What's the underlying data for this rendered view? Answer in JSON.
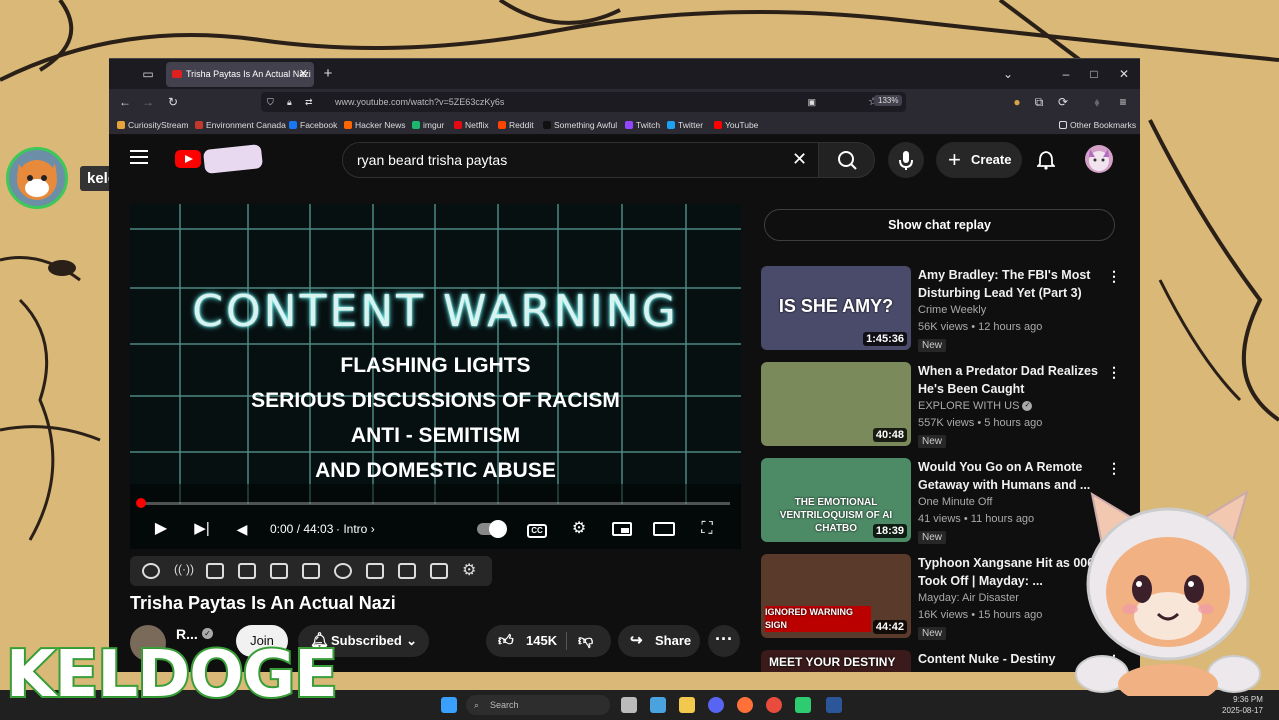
{
  "stream": {
    "username": "keldoge",
    "logo_text": "KELDOGE"
  },
  "browser": {
    "tab_title": "Trisha Paytas Is An Actual Nazi",
    "url": "www.youtube.com/watch?v=5ZE63czKy6s",
    "zoom": "133%",
    "bookmarks": [
      {
        "label": "CuriosityStream",
        "color": "#e6a23c"
      },
      {
        "label": "Environment Canada",
        "color": "#c0392b"
      },
      {
        "label": "Facebook",
        "color": "#1877f2"
      },
      {
        "label": "Hacker News",
        "color": "#ff6600"
      },
      {
        "label": "imgur",
        "color": "#1bb76e"
      },
      {
        "label": "Netflix",
        "color": "#e50914"
      },
      {
        "label": "Reddit",
        "color": "#ff4500"
      },
      {
        "label": "Something Awful",
        "color": "#333333"
      },
      {
        "label": "Twitch",
        "color": "#9146ff"
      },
      {
        "label": "Twitter",
        "color": "#1da1f2"
      },
      {
        "label": "YouTube",
        "color": "#ff0000"
      }
    ],
    "other_bookmarks": "Other Bookmarks"
  },
  "youtube": {
    "search_query": "ryan beard trisha paytas",
    "create_label": "Create",
    "player": {
      "warning_title": "CONTENT WARNING",
      "warning_lines": [
        "FLASHING LIGHTS",
        "SERIOUS DISCUSSIONS OF RACISM",
        "ANTI - SEMITISM",
        "AND DOMESTIC ABUSE"
      ],
      "time": "0:00 / 44:03",
      "chapter": "Intro",
      "cc": "CC",
      "progress": 0.0
    },
    "video_title": "Trisha Paytas Is An Actual Nazi",
    "channel_name": "R...",
    "join_label": "Join",
    "subscribed_label": "Subscribed",
    "likes": "145K",
    "share_label": "Share",
    "chat_replay_label": "Show chat replay",
    "recommendations": [
      {
        "title": "Amy Bradley: The FBI's Most Disturbing Lead Yet (Part 3)",
        "channel": "Crime Weekly",
        "verified": false,
        "views": "56K views",
        "age": "12 hours ago",
        "badge": "New",
        "duration": "1:45:36",
        "thumb_text": "IS SHE AMY?",
        "thumb_color": "#4a4a6a"
      },
      {
        "title": "When a Predator Dad Realizes He's Been Caught",
        "channel": "EXPLORE WITH US",
        "verified": true,
        "views": "557K views",
        "age": "5 hours ago",
        "badge": "New",
        "duration": "40:48",
        "thumb_text": "",
        "thumb_color": "#7a8a5a"
      },
      {
        "title": "Would You Go on A Remote Getaway with Humans and ...",
        "channel": "One Minute Off",
        "verified": false,
        "views": "41 views",
        "age": "11 hours ago",
        "badge": "New",
        "duration": "18:39",
        "thumb_text": "THE EMOTIONAL VENTRILOQUISM OF AI CHATBO",
        "thumb_color": "#4d8a66"
      },
      {
        "title": "Typhoon Xangsane Hit as 006 Took Off | Mayday: ...",
        "channel": "Mayday: Air Disaster",
        "verified": false,
        "views": "16K views",
        "age": "15 hours ago",
        "badge": "New",
        "duration": "44:42",
        "thumb_text": "IGNORED WARNING SIGN",
        "thumb_color": "#5a3a2a"
      },
      {
        "title": "Content Nuke - Destiny",
        "channel": "",
        "verified": false,
        "views": "",
        "age": "",
        "badge": "",
        "duration": "",
        "thumb_text": "MEET YOUR DESTINY",
        "thumb_color": "#3a1a1a"
      }
    ]
  },
  "taskbar": {
    "search_placeholder": "Search",
    "time": "9:36 PM",
    "date": "2025-08-17"
  }
}
